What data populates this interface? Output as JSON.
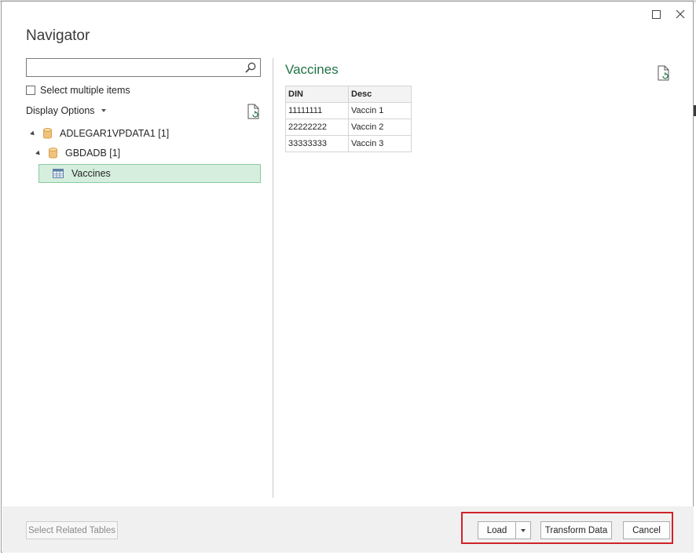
{
  "window": {
    "title": "Navigator",
    "maximize_icon": "maximize-icon",
    "close_icon": "close-icon"
  },
  "search": {
    "value": "",
    "placeholder": "",
    "icon": "search-icon"
  },
  "select_multiple": {
    "label": "Select multiple items",
    "checked": false
  },
  "display_options": {
    "label": "Display Options",
    "icon": "chevron-down-icon"
  },
  "tree": {
    "server": {
      "label": "ADLEGAR1VPDATA1 [1]",
      "icon": "database-icon",
      "expanded": true
    },
    "database": {
      "label": "GBDADB [1]",
      "icon": "database-icon",
      "expanded": true
    },
    "table": {
      "label": "Vaccines",
      "icon": "table-icon",
      "selected": true
    }
  },
  "preview": {
    "title": "Vaccines",
    "columns": [
      "DIN",
      "Desc"
    ],
    "rows": [
      [
        "11111111",
        "Vaccin 1"
      ],
      [
        "22222222",
        "Vaccin 2"
      ],
      [
        "33333333",
        "Vaccin 3"
      ]
    ]
  },
  "footer": {
    "select_related": "Select Related Tables",
    "load": "Load",
    "transform": "Transform Data",
    "cancel": "Cancel"
  },
  "colors": {
    "accent_green": "#217346",
    "selected_bg": "#d6eedd",
    "highlight_red": "#d0232a"
  }
}
